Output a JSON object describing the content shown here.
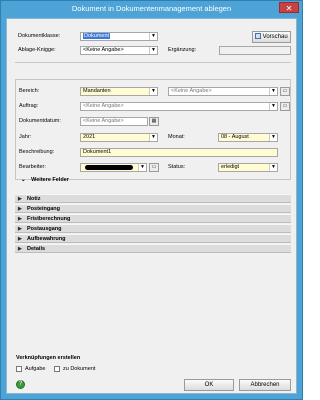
{
  "window": {
    "title": "Dokument in Dokumentenmanagement ablegen",
    "close_glyph": "✕"
  },
  "top": {
    "dokumentklasse_label": "Dokumentklasse:",
    "dokumentklasse_value": "Dokument",
    "vorschau_label": "Vorschau",
    "ablage_knigge_label": "Ablage-Knigge:",
    "ablage_knigge_value": "<Keine Angabe>",
    "ergaenzung_label": "Ergänzung:"
  },
  "form": {
    "bereich_label": "Bereich:",
    "bereich_value": "Mandanten",
    "bereich_extra_value": "<Keine Angabe>",
    "auftrag_label": "Auftrag:",
    "auftrag_value": "<Keine Angabe>",
    "dokumentdatum_label": "Dokumentdatum:",
    "dokumentdatum_value": "<Keine Angabe>",
    "jahr_label": "Jahr:",
    "jahr_value": "2021",
    "monat_label": "Monat:",
    "monat_value": "08 - August",
    "beschreibung_label": "Beschreibung:",
    "beschreibung_value": "Dokument1",
    "bearbeiter_label": "Bearbeiter:",
    "status_label": "Status:",
    "status_value": "erledigt",
    "weitere_felder_label": "Weitere Felder"
  },
  "sections": [
    {
      "label": "Notiz"
    },
    {
      "label": "Posteingang"
    },
    {
      "label": "Fristberechnung"
    },
    {
      "label": "Postausgang"
    },
    {
      "label": "Aufbewahrung"
    },
    {
      "label": "Details"
    }
  ],
  "links": {
    "heading": "Verknüpfungen erstellen",
    "aufgabe_label": "Aufgabe",
    "zu_dokument_label": "zu Dokument"
  },
  "buttons": {
    "ok": "OK",
    "abbrechen": "Abbrechen"
  },
  "icons": {
    "close": "close-icon",
    "vorschau": "preview-icon",
    "calendar": "calendar-icon",
    "browse": "browse-icon",
    "help": "help-icon"
  },
  "colors": {
    "titlebar": "#4ea3d6",
    "required_field": "#fffbd2",
    "close": "#c74343"
  }
}
